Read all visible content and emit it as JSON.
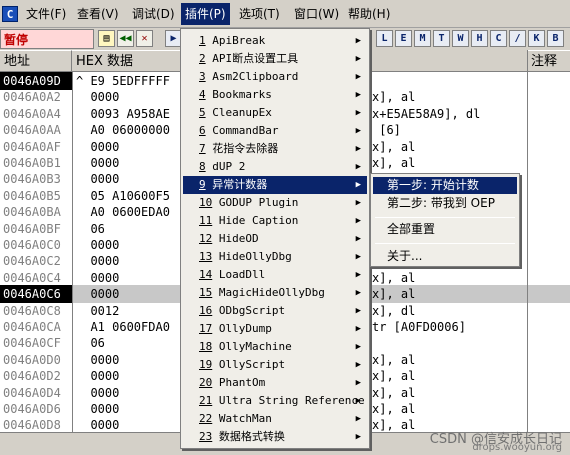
{
  "menubar": {
    "items": [
      "文件(F)",
      "查看(V)",
      "调试(D)",
      "插件(P)",
      "选项(T)",
      "窗口(W)",
      "帮助(H)"
    ],
    "active_index": 3,
    "app_icon": "C"
  },
  "toolbar": {
    "status": "暂停",
    "letters": [
      "L",
      "E",
      "M",
      "T",
      "W",
      "H",
      "C",
      "/",
      "K",
      "B"
    ]
  },
  "headers": {
    "address": "地址",
    "hex": "HEX 数据",
    "comment": "注释"
  },
  "rows": [
    {
      "addr": "0046A09D",
      "hex": "^ E9 5EDFFFFF",
      "dis": "",
      "sel": "top"
    },
    {
      "addr": "0046A0A2",
      "hex": "  0000",
      "dis": "x], al"
    },
    {
      "addr": "0046A0A4",
      "hex": "  0093 A958AE",
      "dis": "x+E5AE58A9], dl"
    },
    {
      "addr": "0046A0AA",
      "hex": "  A0 06000000",
      "dis": " [6]"
    },
    {
      "addr": "0046A0AF",
      "hex": "  0000",
      "dis": "x], al"
    },
    {
      "addr": "0046A0B1",
      "hex": "  0000",
      "dis": "x], al"
    },
    {
      "addr": "0046A0B3",
      "hex": "  0000",
      "dis": ""
    },
    {
      "addr": "0046A0B5",
      "hex": "  05 A10600F5",
      "dis": ""
    },
    {
      "addr": "0046A0BA",
      "hex": "  A0 0600EDA0",
      "dis": ""
    },
    {
      "addr": "0046A0BF",
      "hex": "  06",
      "dis": ""
    },
    {
      "addr": "0046A0C0",
      "hex": "  0000",
      "dis": ""
    },
    {
      "addr": "0046A0C2",
      "hex": "  0000",
      "dis": "x], al"
    },
    {
      "addr": "0046A0C4",
      "hex": "  0000",
      "dis": "x], al"
    },
    {
      "addr": "0046A0C6",
      "hex": "  0000",
      "dis": "x], al",
      "sel": "gray"
    },
    {
      "addr": "0046A0C8",
      "hex": "  0012",
      "dis": "x], dl"
    },
    {
      "addr": "0046A0CA",
      "hex": "  A1 0600FDA0",
      "dis": "tr [A0FD0006]"
    },
    {
      "addr": "0046A0CF",
      "hex": "  06",
      "dis": ""
    },
    {
      "addr": "0046A0D0",
      "hex": "  0000",
      "dis": "x], al"
    },
    {
      "addr": "0046A0D2",
      "hex": "  0000",
      "dis": "x], al"
    },
    {
      "addr": "0046A0D4",
      "hex": "  0000",
      "dis": "x], al"
    },
    {
      "addr": "0046A0D6",
      "hex": "  0000",
      "dis": "x], al"
    },
    {
      "addr": "0046A0D8",
      "hex": "  0000",
      "dis": "x], al"
    }
  ],
  "plugin_menu": [
    {
      "num": "1",
      "label": "ApiBreak"
    },
    {
      "num": "2",
      "label": "API断点设置工具"
    },
    {
      "num": "3",
      "label": "Asm2Clipboard"
    },
    {
      "num": "4",
      "label": "Bookmarks"
    },
    {
      "num": "5",
      "label": "CleanupEx"
    },
    {
      "num": "6",
      "label": "CommandBar"
    },
    {
      "num": "7",
      "label": "花指令去除器"
    },
    {
      "num": "8",
      "label": "dUP 2"
    },
    {
      "num": "9",
      "label": "异常计数器",
      "highlight": true
    },
    {
      "num": "10",
      "label": "GODUP Plugin"
    },
    {
      "num": "11",
      "label": "Hide Caption"
    },
    {
      "num": "12",
      "label": "HideOD"
    },
    {
      "num": "13",
      "label": "HideOllyDbg"
    },
    {
      "num": "14",
      "label": "LoadDll"
    },
    {
      "num": "15",
      "label": "MagicHideOllyDbg"
    },
    {
      "num": "16",
      "label": "ODbgScript"
    },
    {
      "num": "17",
      "label": "OllyDump"
    },
    {
      "num": "18",
      "label": "OllyMachine"
    },
    {
      "num": "19",
      "label": "OllyScript"
    },
    {
      "num": "20",
      "label": "PhantOm"
    },
    {
      "num": "21",
      "label": "Ultra String Reference"
    },
    {
      "num": "22",
      "label": "WatchMan"
    },
    {
      "num": "23",
      "label": "数据格式转换"
    }
  ],
  "submenu": {
    "items": [
      "第一步: 开始计数",
      "第二步: 带我到 OEP",
      "全部重置",
      "关于..."
    ],
    "highlight_index": 0
  },
  "watermark": {
    "line1": "CSDN @信安成长日记",
    "line2": "drops.wooyun.org"
  }
}
